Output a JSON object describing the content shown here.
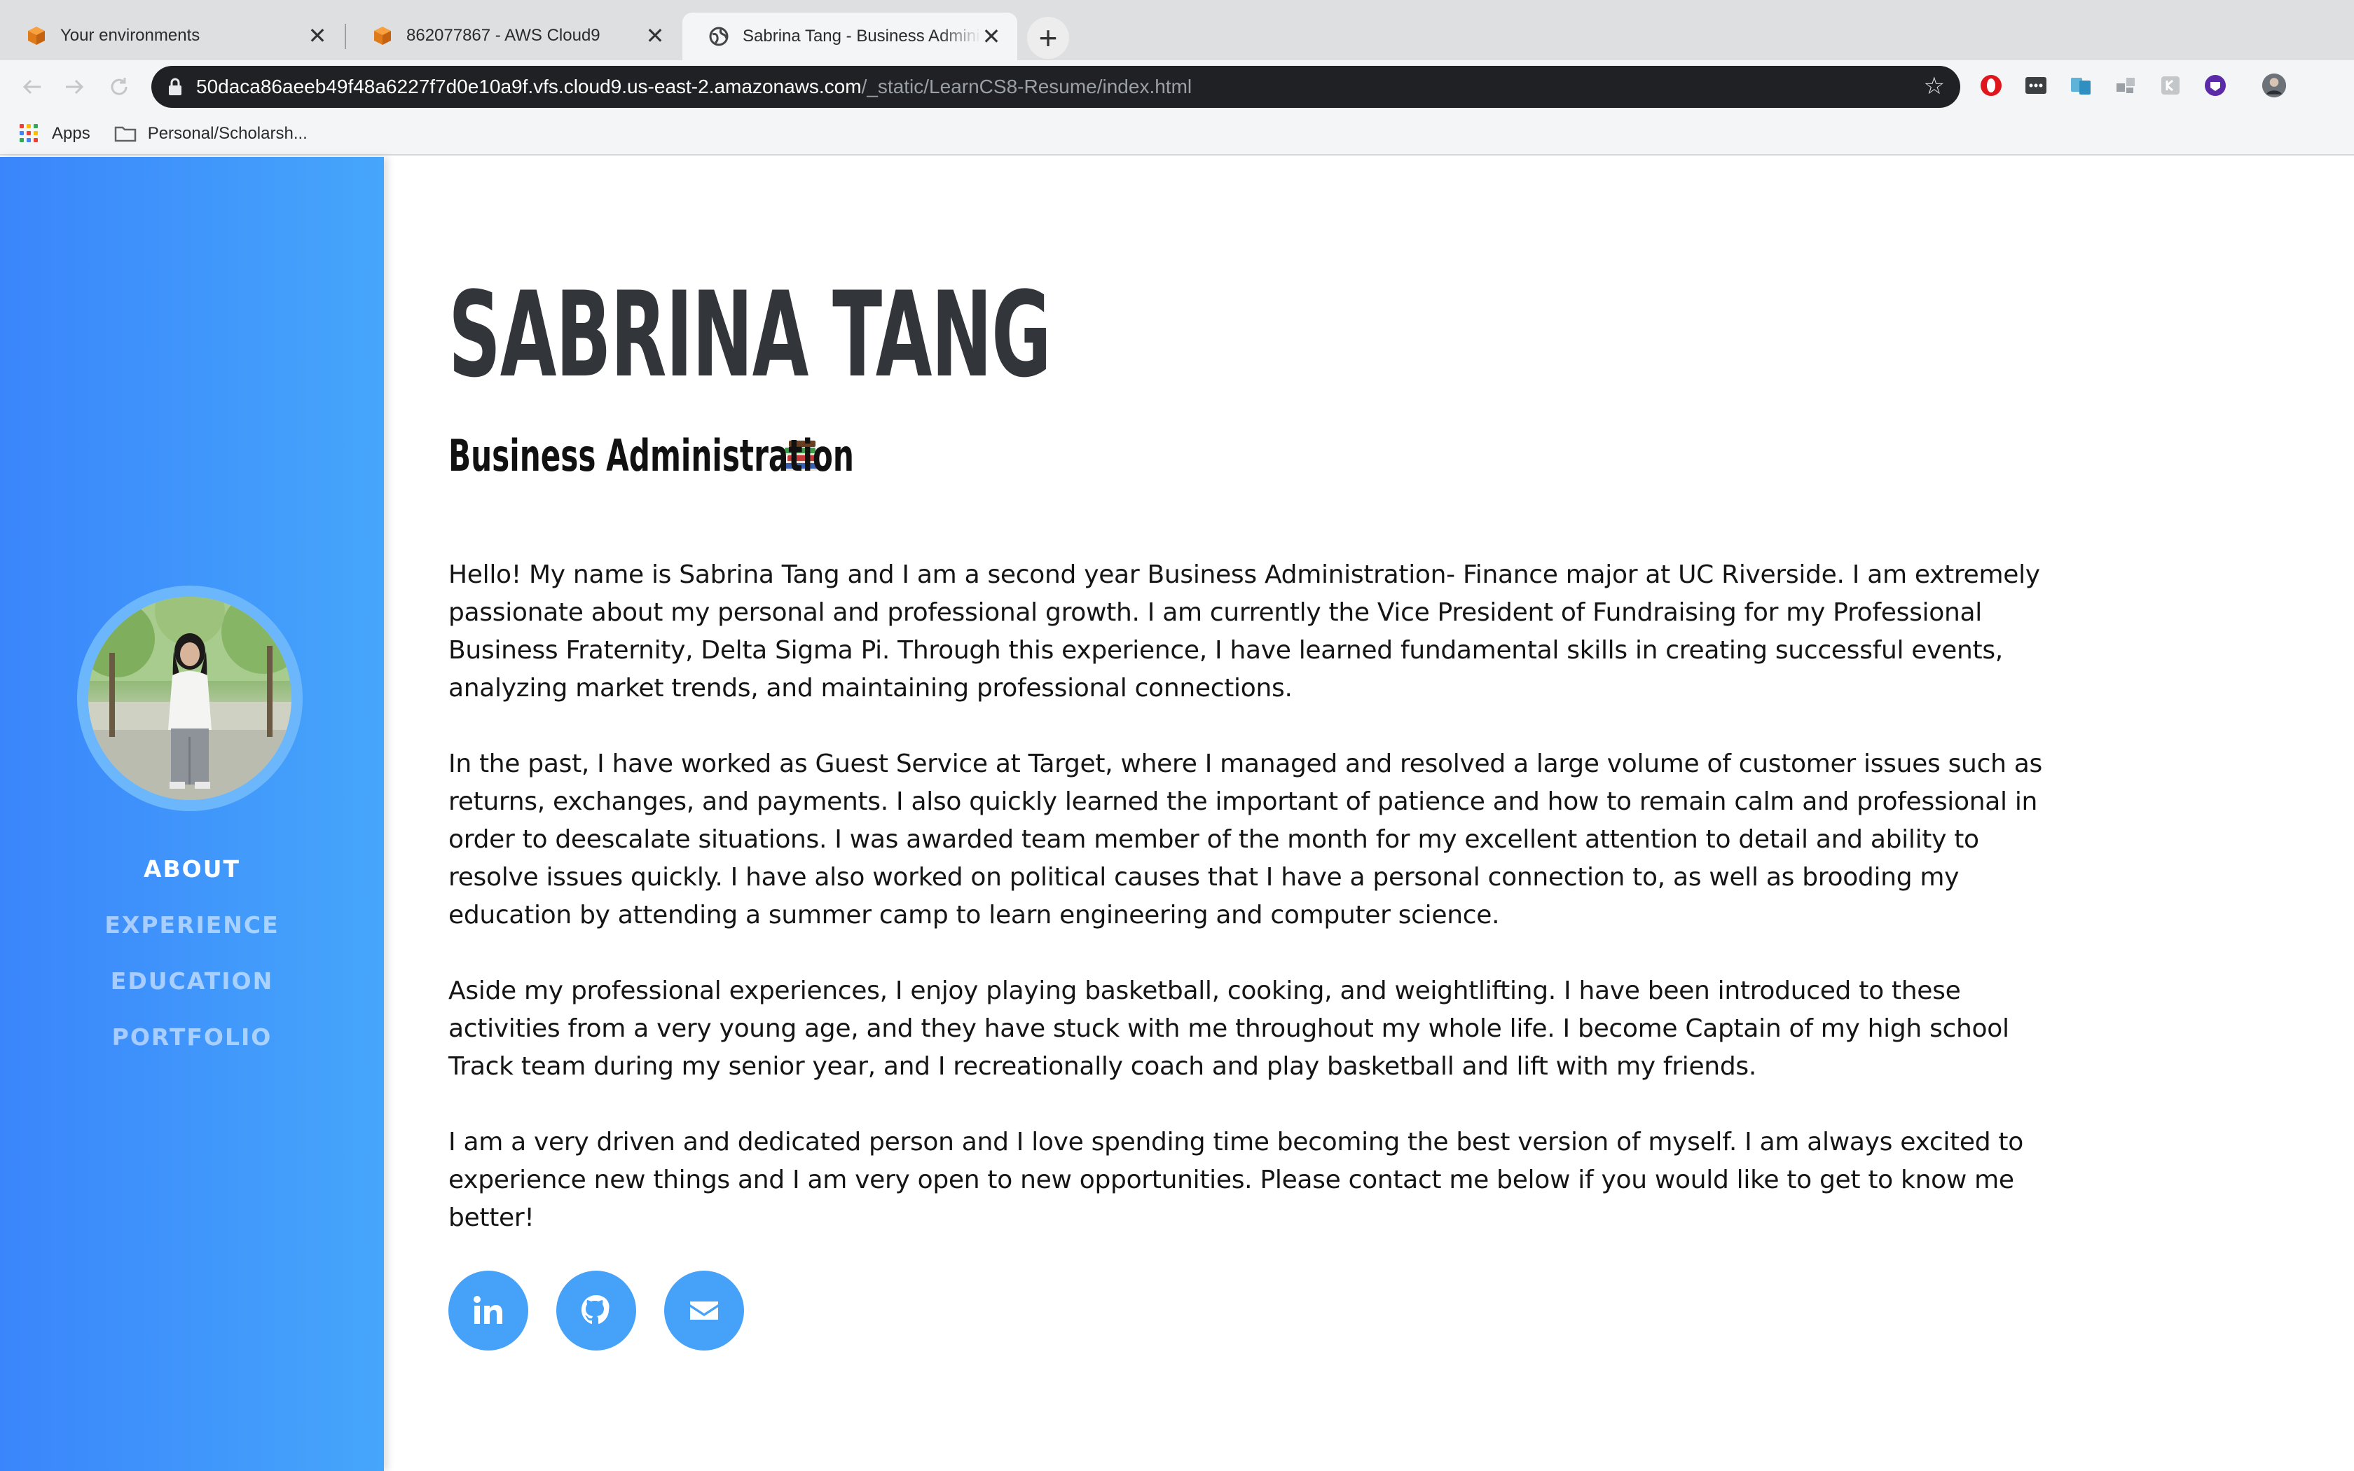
{
  "browser": {
    "tabs": [
      {
        "title": "Your environments",
        "favicon": "aws-cube-icon",
        "active": false
      },
      {
        "title": "862077867 - AWS Cloud9",
        "favicon": "aws-cube-icon",
        "active": false
      },
      {
        "title": "Sabrina Tang - Business Adminis",
        "favicon": "globe-icon",
        "active": true
      }
    ],
    "tab_close_glyph": "✕",
    "new_tab_glyph": "+",
    "address": {
      "host": "50daca86aeeb49f48a6227f7d0e10a9f.vfs.cloud9.us-east-2.amazonaws.com",
      "path": "/_static/LearnCS8-Resume/index.html"
    },
    "bookmarks": [
      {
        "label": "Apps",
        "icon": "apps-grid-icon"
      },
      {
        "label": "Personal/Scholarsh...",
        "icon": "folder-icon"
      }
    ],
    "extensions": [
      "opera-icon",
      "password-icon",
      "translate-icon",
      "puzzle-icon",
      "reader-icon",
      "vpn-icon",
      "profile-avatar-icon"
    ]
  },
  "sidebar": {
    "nav": [
      {
        "label": "ABOUT",
        "active": true
      },
      {
        "label": "EXPERIENCE",
        "active": false
      },
      {
        "label": "EDUCATION",
        "active": false
      },
      {
        "label": "PORTFOLIO",
        "active": false
      }
    ],
    "colors": {
      "gradient_start": "#3a85fb",
      "gradient_end": "#46a6fb"
    }
  },
  "main": {
    "name": "SABRINA TANG",
    "subtitle": "Business Administration",
    "subtitle_emoji": "books-icon",
    "paragraphs": [
      "Hello! My name is Sabrina Tang and I am a second year Business Administration- Finance major at UC Riverside. I am extremely passionate about my personal and professional growth. I am currently the Vice President of Fundraising for my Professional Business Fraternity, Delta Sigma Pi. Through this experience, I have learned fundamental skills in creating successful events, analyzing market trends, and maintaining professional connections.",
      "In the past, I have worked as Guest Service at Target, where I managed and resolved a large volume of customer issues such as returns, exchanges, and payments. I also quickly learned the important of patience and how to remain calm and professional in order to deescalate situations. I was awarded team member of the month for my excellent attention to detail and ability to resolve issues quickly. I have also worked on political causes that I have a personal connection to, as well as brooding my education by attending a summer camp to learn engineering and computer science.",
      "Aside my professional experiences, I enjoy playing basketball, cooking, and weightlifting. I have been introduced to these activities from a very young age, and they have stuck with me throughout my whole life. I become Captain of my high school Track team during my senior year, and I recreationally coach and play basketball and lift with my friends.",
      "I am a very driven and dedicated person and I love spending time becoming the best version of myself. I am always excited to experience new things and I am very open to new opportunities. Please contact me below if you would like to get to know me better!"
    ],
    "social": [
      "linkedin-icon",
      "github-icon",
      "email-icon"
    ],
    "accent_color": "#45a2f8"
  }
}
